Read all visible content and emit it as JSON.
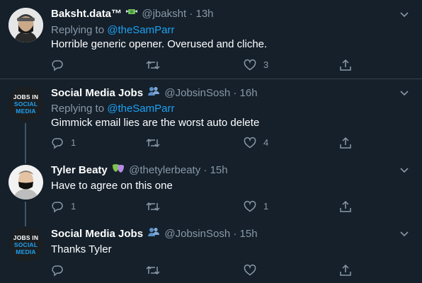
{
  "tweets": [
    {
      "name": "Baksht.data™",
      "badge": "money-wings-emoji",
      "handle": "@jbaksht",
      "time": "13h",
      "replying_prefix": "Replying to",
      "replying_to": "@theSamParr",
      "text": "Horrible generic opener. Overused and cliche.",
      "reply_count": "",
      "retweet_count": "",
      "like_count": "3"
    },
    {
      "name": "Social Media Jobs",
      "badge": "people-emoji",
      "handle": "@JobsinSosh",
      "time": "16h",
      "replying_prefix": "Replying to",
      "replying_to": "@theSamParr",
      "text": "Gimmick email lies are the worst auto delete",
      "reply_count": "1",
      "retweet_count": "",
      "like_count": "4",
      "logo": {
        "line1": "JOBS IN",
        "line2": "SOCIAL",
        "line3": "MEDIA"
      }
    },
    {
      "name": "Tyler Beaty",
      "badge": "theater-masks-emoji",
      "handle": "@thetylerbeaty",
      "time": "15h",
      "text": "Have to agree on this one",
      "reply_count": "1",
      "retweet_count": "",
      "like_count": "1"
    },
    {
      "name": "Social Media Jobs",
      "badge": "people-emoji",
      "handle": "@JobsinSosh",
      "time": "15h",
      "text": "Thanks Tyler",
      "reply_count": "",
      "retweet_count": "",
      "like_count": "",
      "logo": {
        "line1": "JOBS IN",
        "line2": "SOCIAL",
        "line3": "MEDIA"
      }
    }
  ],
  "separator": "·",
  "colors": {
    "background": "#15202b",
    "muted": "#8899a6",
    "accent": "#1da1f2",
    "divider": "#38444d"
  }
}
